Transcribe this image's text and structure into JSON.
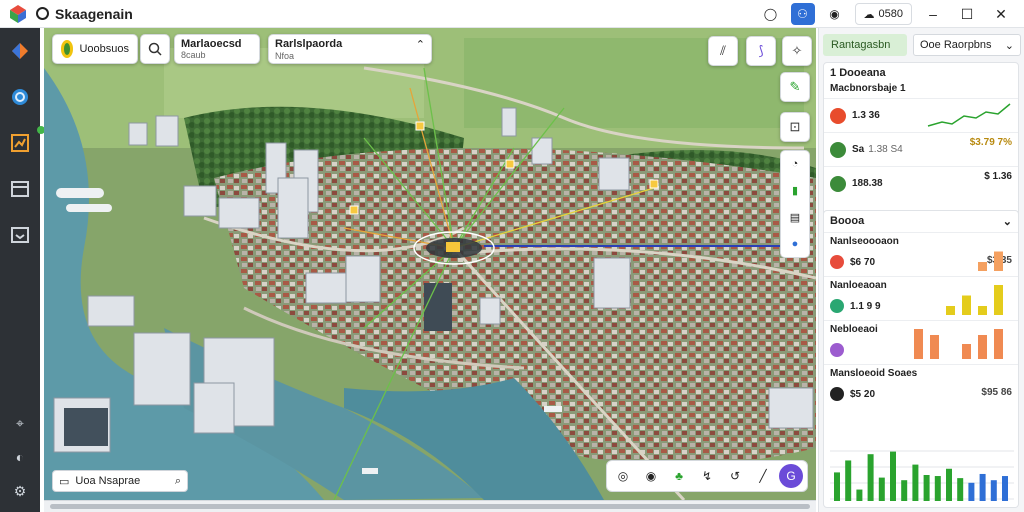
{
  "app": {
    "title": "Skaagenain"
  },
  "topbar": {
    "status_label": "0580",
    "icons": [
      "chat-icon",
      "chart-icon",
      "record-icon",
      "minimize-icon",
      "maximize-icon",
      "close-icon"
    ]
  },
  "sidebar": {
    "items": [
      {
        "name": "layers",
        "icon": "cube-icon"
      },
      {
        "name": "navigate",
        "icon": "diamond-icon"
      },
      {
        "name": "globe",
        "icon": "globe-icon"
      },
      {
        "name": "analytics",
        "icon": "chart-icon"
      },
      {
        "name": "media",
        "icon": "film-icon"
      },
      {
        "name": "inbox",
        "icon": "inbox-icon"
      }
    ],
    "bottom": [
      "pin-icon",
      "help-icon",
      "settings-icon"
    ]
  },
  "map": {
    "layer_toggle": "Uoobsuos",
    "info_card_1": {
      "title": "Marlaoecsd",
      "sub": "8caub"
    },
    "info_card_2": {
      "title": "Rarlslpaorda",
      "sub": "Nfoa"
    },
    "search_placeholder": "Uoa Nsaprae",
    "hub_label": "ffa"
  },
  "panel": {
    "tab_active": "Rantagasbn",
    "tab_dropdown": "Ooe Raorpbns",
    "summary": {
      "title": "Dooeana",
      "prefix": "1",
      "header": "Macbnorsbaje 1",
      "rows": [
        {
          "value": "1.3 36",
          "sub": "",
          "color": "#e84c2c"
        },
        {
          "value": "Sa",
          "sub": "1.38 S4",
          "right": "$3.79 7%",
          "color": "#3c8b3a"
        },
        {
          "value": "188.38",
          "sub": "",
          "right": "$ 1.36",
          "color": "#3c8b3a"
        }
      ]
    },
    "detail": {
      "title": "Boooa",
      "blocks": [
        {
          "label": "Nanlseoooaon",
          "value": "$6 70",
          "right": "$3 35",
          "dot": "#e74c3c",
          "bars": [
            0.0,
            0.0,
            0.0,
            0.0,
            0.3,
            0.65
          ],
          "bar_color": "#f4a060"
        },
        {
          "label": "Nanloeaoan",
          "value": "1.1 9 9",
          "right": "",
          "dot": "#2aa772",
          "bars": [
            0.0,
            0.0,
            0.3,
            0.65,
            0.3,
            1.0
          ],
          "bar_color": "#e4cc1c"
        },
        {
          "label": "Nebloeaoi",
          "value": "",
          "right": "",
          "dot": "#9c5ccf",
          "bars": [
            1.0,
            0.8,
            0.0,
            0.5,
            0.8,
            1.0
          ],
          "bar_color": "#f08a52"
        },
        {
          "label": "Mansloeoid Soaes",
          "value": "$5 20",
          "right": "$95 86",
          "dot": "#222222",
          "bars": [],
          "bar_color": "#2aa32e"
        }
      ],
      "chart_values": [
        0.55,
        0.78,
        0.22,
        0.9,
        0.45,
        0.95,
        0.4,
        0.7,
        0.5,
        0.48,
        0.62,
        0.44,
        0.35,
        0.52,
        0.4,
        0.48
      ]
    }
  },
  "colors": {
    "accent": "#2f6fd6",
    "green": "#2aa32e",
    "water": "#5d9aa8"
  }
}
